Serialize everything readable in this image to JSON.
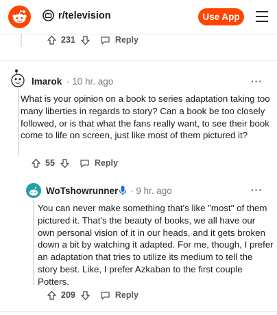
{
  "header": {
    "subreddit": "r/television",
    "use_app_label": "Use App"
  },
  "top_actions": {
    "score": "231",
    "reply_label": "Reply"
  },
  "comment1": {
    "author": "lmarok",
    "time": "· 10 hr. ago",
    "more": "···",
    "body": "What is your opinion on a book to series adaptation taking too many liberties in regards to story? Can a book be too closely followed, or is that what the fans really want, to see their book come to life on screen, just like most of them pictured it?",
    "score": "55",
    "reply_label": "Reply"
  },
  "comment2": {
    "author": "WoTshowrunner",
    "time": "· 9 hr. ago",
    "more": "···",
    "body": "You can never make something that's like \"most\" of them pictured it. That's the beauty of books, we all have our own personal vision of it in our heads, and it gets broken down a bit by watching it adapted. For me, though, I prefer an adaptation that tries to utilize its medium to tell the story best. Like, I prefer Azkaban to the first couple Potters.",
    "score": "209",
    "reply_label": "Reply"
  },
  "colors": {
    "brand": "#ff4500",
    "avatar_teal": "#24a0a8",
    "mic_blue": "#1a73c9"
  },
  "icons": [
    "reddit-logo-icon",
    "subreddit-icon",
    "hamburger-menu-icon",
    "upvote-icon",
    "downvote-icon",
    "reply-icon",
    "more-options-icon",
    "mic-icon"
  ]
}
